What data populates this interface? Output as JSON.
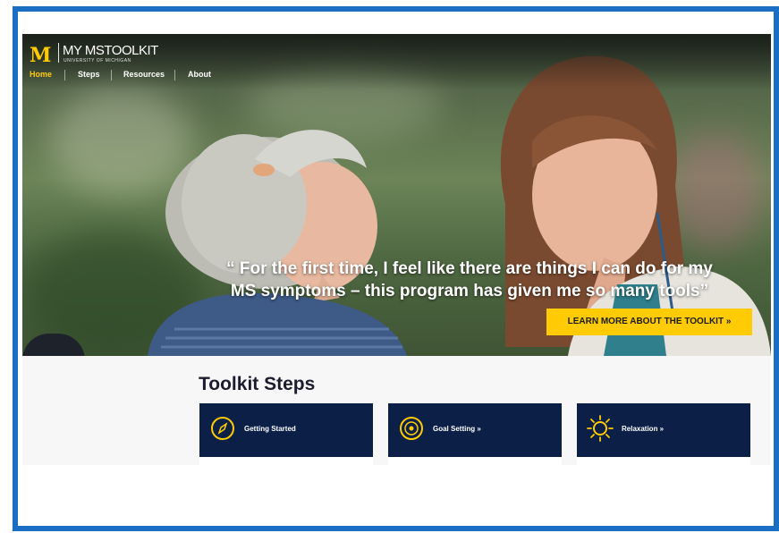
{
  "brand": {
    "logo_letter": "M",
    "title": "MY MSTOOLKIT",
    "subtitle": "UNIVERSITY OF MICHIGAN"
  },
  "nav": {
    "items": [
      {
        "label": "Home",
        "active": true
      },
      {
        "label": "Steps",
        "active": false
      },
      {
        "label": "Resources",
        "active": false
      },
      {
        "label": "About",
        "active": false
      }
    ]
  },
  "hero": {
    "quote_line1": "“ For the first time, I feel like there are things I can do for my",
    "quote_line2": "MS symptoms – this program has given me so many tools”",
    "cta_label": "LEARN MORE ABOUT THE TOOLKIT »"
  },
  "steps": {
    "title": "Toolkit Steps",
    "cards": [
      {
        "label": "Getting Started",
        "icon": "compass-icon"
      },
      {
        "label": "Goal Setting »",
        "icon": "target-icon"
      },
      {
        "label": "Relaxation »",
        "icon": "sun-icon"
      }
    ]
  },
  "colors": {
    "frame_border": "#1a6fc5",
    "brand_maize": "#ffcb05",
    "card_navy": "#0b1f47",
    "nav_active": "#ffcb05"
  }
}
